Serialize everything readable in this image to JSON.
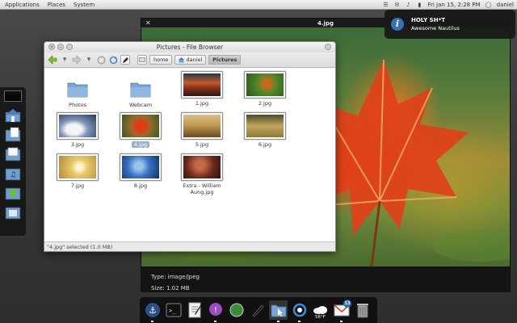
{
  "top_panel": {
    "menus": [
      "Applications",
      "Places",
      "System"
    ],
    "clock": "Fri Jan 15,  2:28 PM",
    "user": "daniel"
  },
  "notification": {
    "title": "HOLY SH*T",
    "body": "Awesome Nautilus"
  },
  "viewer": {
    "title": "4.jpg",
    "type_line": "Type: image/jpeg",
    "size_line": "Size: 1.02 MB"
  },
  "browser": {
    "title": "Pictures - File Browser",
    "breadcrumbs": [
      "home",
      "daniel",
      "Pictures"
    ],
    "files": [
      {
        "label": "Photos"
      },
      {
        "label": "Webcam"
      },
      {
        "label": "1.jpg"
      },
      {
        "label": "2.jpg"
      },
      {
        "label": "3.jpg"
      },
      {
        "label": "4.jpg"
      },
      {
        "label": "5.jpg"
      },
      {
        "label": "6.jpg"
      },
      {
        "label": "7.jpg"
      },
      {
        "label": "8.jpg"
      },
      {
        "label": "Extra - William Aung.jpg"
      }
    ],
    "status": "\"4.jpg\" selected (1.0 MB)"
  },
  "dock": {
    "weather_temp": "56°F",
    "mail_badge": "13"
  },
  "colors": {
    "selection": "#9ab0c8",
    "notification_bg": "#191919",
    "info_icon": "#3b6fb6",
    "leaf": "#e23a16"
  }
}
